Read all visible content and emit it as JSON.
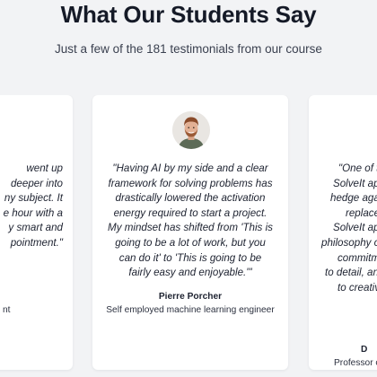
{
  "section": {
    "title": "What Our Students Say",
    "subtitle": "Just a few of the 181 testimonials from our course"
  },
  "testimonials": [
    {
      "quote_lines": [
        "went up",
        "deeper into",
        "ny subject. It",
        "e hour with a",
        "y smart and",
        "pointment.\""
      ],
      "name": "",
      "role": "nt"
    },
    {
      "quote_lines": [
        "\"Having AI by my side and a clear",
        "framework for solving problems has",
        "drastically lowered the activation",
        "energy required to start a project.",
        "My mindset has shifted from 'This is",
        "going to be a lot of work, but you",
        "can do it' to 'This is going to be",
        "fairly easy and enjoyable.'\""
      ],
      "name": "Pierre Porcher",
      "role": "Self employed machine learning engineer",
      "avatar": "person-avatar"
    },
    {
      "quote_lines": [
        "\"One of t",
        "SolveIt ap",
        "hedge aga",
        "replace th",
        "SolveIt ap",
        "philosophy o",
        "commitme",
        "to detail, an",
        "to creativ"
      ],
      "name": "D",
      "role": "Professor o"
    }
  ]
}
